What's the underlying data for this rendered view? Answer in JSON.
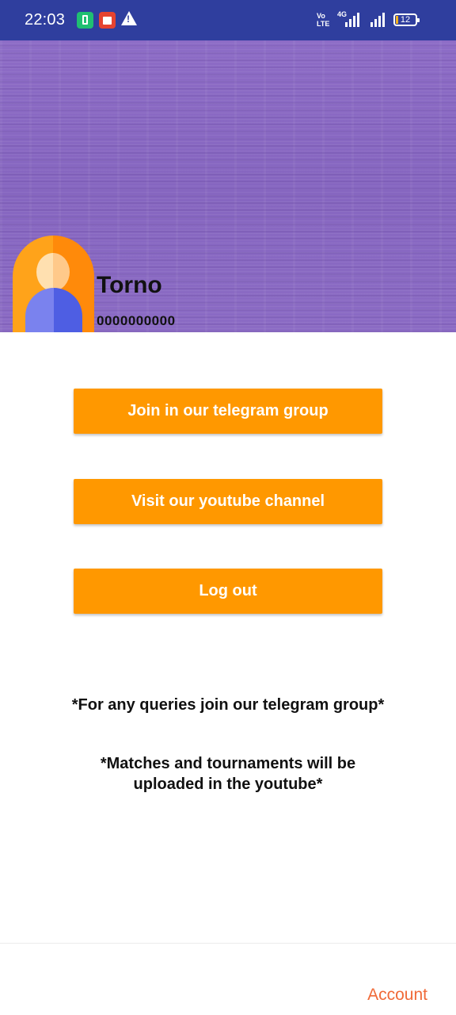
{
  "status_bar": {
    "time": "22:03",
    "volte_label": "Vo LTE",
    "network_label": "4G",
    "battery_level": "12",
    "icons": [
      "battery-saver-icon",
      "shop-icon",
      "warning-icon",
      "signal-icon",
      "battery-icon"
    ]
  },
  "profile": {
    "name": "Torno",
    "phone": "0000000000",
    "header_color": "#8a6ac2"
  },
  "actions": {
    "telegram_label": "Join in our telegram group",
    "youtube_label": "Visit our youtube channel",
    "logout_label": "Log out",
    "button_color": "#ff9800"
  },
  "info": {
    "queries_text": "*For any queries join our telegram group*",
    "uploads_text": "*Matches and tournaments will be uploaded in the youtube*"
  },
  "bottom_nav": {
    "account_label": "Account",
    "accent_color": "#f06a38"
  }
}
